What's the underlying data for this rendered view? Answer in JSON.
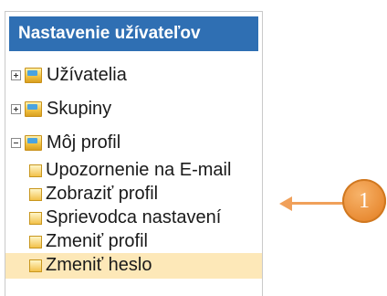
{
  "panel": {
    "title": "Nastavenie užívateľov"
  },
  "tree": {
    "users": "Užívatelia",
    "groups": "Skupiny",
    "my_profile": "Môj profil",
    "email_notification": "Upozornenie na E-mail",
    "view_profile": "Zobraziť profil",
    "setup_wizard": "Sprievodca nastavení",
    "edit_profile": "Zmeniť profil",
    "change_password": "Zmeniť heslo"
  },
  "callout": {
    "number": "1"
  },
  "colors": {
    "header_bg": "#2f6fb3",
    "selected_row": "#fde8b8",
    "callout": "#e88a32"
  }
}
